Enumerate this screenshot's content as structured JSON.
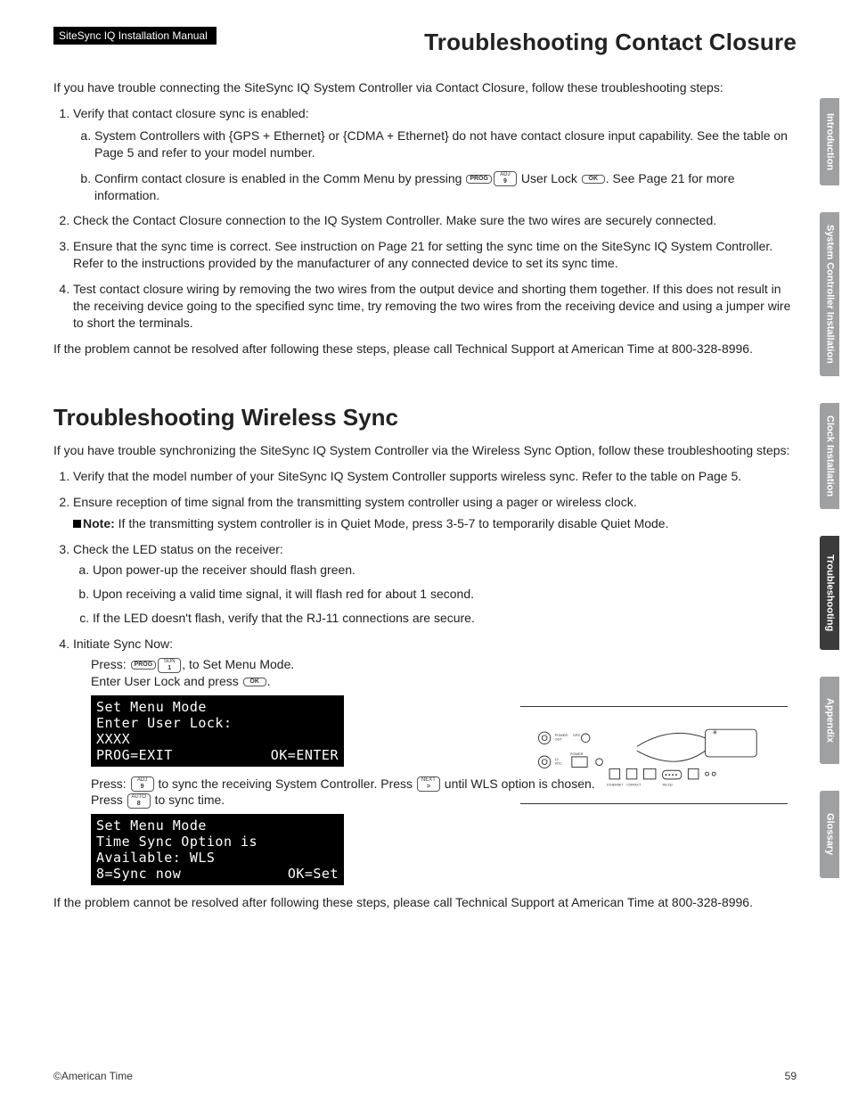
{
  "header": {
    "manual_tag": "SiteSync IQ Installation Manual",
    "title_right": "Troubleshooting Contact Closure"
  },
  "section1": {
    "intro": "If you have trouble connecting the SiteSync IQ System Controller via Contact Closure, follow these troubleshooting steps:",
    "items": [
      {
        "text": "Verify that contact closure sync is enabled:",
        "sub": [
          "System Controllers with {GPS + Ethernet} or {CDMA + Ethernet} do not have contact closure input capability. See the table on Page 5 and refer to your model number.",
          "Confirm contact closure is enabled in the Comm Menu by pressing ",
          " User Lock ",
          ". See Page 21 for more information."
        ]
      },
      {
        "text": "Check the Contact Closure connection to the IQ System Controller. Make sure the two wires are securely connected."
      },
      {
        "text": "Ensure that the sync time is correct. See instruction on Page 21 for setting the sync time on the SiteSync IQ System Controller. Refer to the instructions provided by the manufacturer of any connected device to set its sync time."
      },
      {
        "text": "Test contact closure wiring by removing the two wires from the output device and shorting them together. If this does not result in the receiving device going to the specified sync time, try removing the two wires from the receiving device and using a jumper wire to short the terminals."
      }
    ],
    "outro": "If the problem cannot be resolved after following these steps, please call Technical Support at American Time at 800-328-8996."
  },
  "section2": {
    "title": "Troubleshooting Wireless Sync",
    "intro": "If you have trouble synchronizing the SiteSync IQ System Controller via the Wireless Sync Option, follow these troubleshooting steps:",
    "items": {
      "i1": "Verify that the model number of your SiteSync IQ System Controller supports wireless sync. Refer to the table on Page 5.",
      "i2": "Ensure reception of time signal from the transmitting system controller using a pager or wireless clock.",
      "i2_note_label": "Note:",
      "i2_note": " If the transmitting system controller is in Quiet Mode, press 3-5-7 to temporarily disable Quiet Mode.",
      "i3": "Check the LED status on the receiver:",
      "i3a": "Upon power-up the receiver should flash green.",
      "i3b": "Upon receiving a valid time signal, it will flash red for about 1 second.",
      "i3c": "If the LED doesn't flash, verify that the RJ-11 connections are secure.",
      "i4": "Initiate Sync Now:",
      "i4_press1a": "Press: ",
      "i4_press1b": ", to Set Menu Mode.",
      "i4_enter_a": "Enter User Lock and press ",
      "i4_enter_b": ".",
      "i4_press2a": "Press: ",
      "i4_press2b": " to sync the receiving System Controller. Press ",
      "i4_press2c": " until WLS option is chosen.",
      "i4_press3a": "Press ",
      "i4_press3b": " to sync time."
    },
    "lcd1": {
      "l1": "Set Menu Mode",
      "l2": "Enter User Lock:",
      "l3": "            XXXX",
      "l4l": "PROG=EXIT",
      "l4r": "OK=ENTER"
    },
    "lcd2": {
      "l1": "Set Menu Mode",
      "l2": "Time Sync Option is",
      "l3": "Available: WLS",
      "l4l": "8=Sync now",
      "l4r": "OK=Set"
    },
    "outro": "If the problem cannot be resolved after following these steps, please call Technical Support at American Time at 800-328-8996."
  },
  "keys": {
    "prog": "PROG",
    "adj9_top": "ADJ",
    "adj9_bot": "9",
    "ok": "OK",
    "sun1_top": "SUN",
    "sun1_bot": "1",
    "next_top": "NEXT",
    "next_bot": ">",
    "auto8_top": "AUTO",
    "auto8_bot": "8"
  },
  "tabs": {
    "t1": "Introduction",
    "t2": "System Controller Installation",
    "t3": "Clock Installation",
    "t4": "Troubleshooting",
    "t5": "Appendix",
    "t6": "Glossary"
  },
  "footer": {
    "left": "©American Time",
    "right": "59"
  }
}
